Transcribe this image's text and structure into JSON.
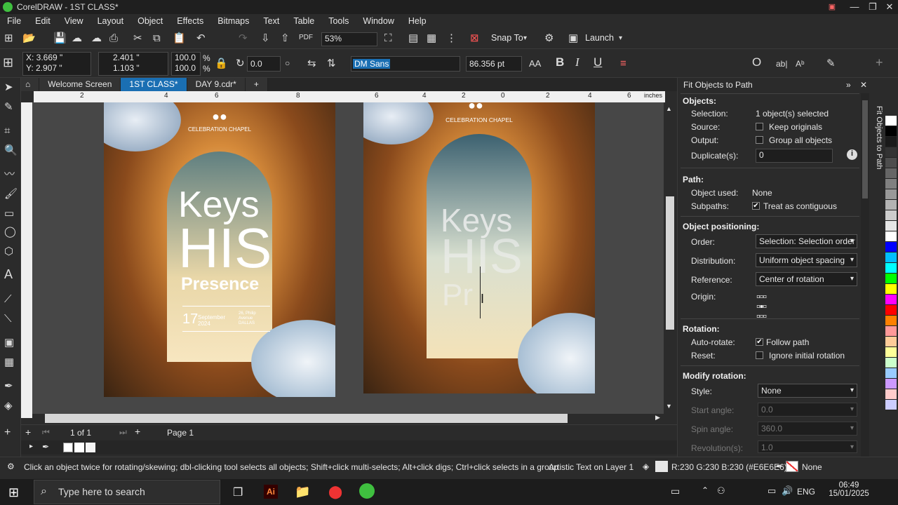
{
  "window": {
    "title": "CorelDRAW - 1ST CLASS*"
  },
  "menu": [
    "File",
    "Edit",
    "View",
    "Layout",
    "Object",
    "Effects",
    "Bitmaps",
    "Text",
    "Table",
    "Tools",
    "Window",
    "Help"
  ],
  "toolbar": {
    "zoom": "53%",
    "snap_label": "Snap To",
    "launch_label": "Launch"
  },
  "propbar": {
    "x": "X: 3.669 \"",
    "y": "Y: 2.907 \"",
    "w": "2.401 \"",
    "h": "1.103 \"",
    "sx": "100.0",
    "sy": "100.0",
    "pct": "%",
    "angle": "0.0",
    "font": "DM Sans",
    "size": "86.356 pt"
  },
  "tabs": [
    "Welcome Screen",
    "1ST CLASS*",
    "DAY 9.cdr*"
  ],
  "ruler": {
    "unit": "inches",
    "ticks": [
      "2",
      "4",
      "6",
      "8",
      "6",
      "4",
      "2",
      "0",
      "2",
      "4",
      "6"
    ]
  },
  "poster1": {
    "brand": "CELEBRATION CHAPEL",
    "title1": "Keys",
    "title2": "HIS",
    "title3": "Presence",
    "day": "17",
    "month": "September",
    "year": "2024",
    "addr1": "26, Philip",
    "addr2": "Avenue",
    "addr3": "DALLAS"
  },
  "poster2": {
    "brand": "CELEBRATION CHAPEL",
    "title1": "Keys",
    "title2": "HIS",
    "title3": "Pr"
  },
  "pagebar": {
    "page_count": "1 of 1",
    "page_tab": "Page 1"
  },
  "docker": {
    "title": "Fit Objects to Path",
    "side_label": "Fit Objects to Path",
    "objects_h": "Objects:",
    "selection_l": "Selection:",
    "selection_v": "1 object(s) selected",
    "source_l": "Source:",
    "source_v": "Keep originals",
    "output_l": "Output:",
    "output_v": "Group all objects",
    "dup_l": "Duplicate(s):",
    "dup_v": "0",
    "path_h": "Path:",
    "objused_l": "Object used:",
    "objused_v": "None",
    "subpaths_l": "Subpaths:",
    "subpaths_v": "Treat as contiguous",
    "pos_h": "Object positioning:",
    "order_l": "Order:",
    "order_v": "Selection: Selection order",
    "dist_l": "Distribution:",
    "dist_v": "Uniform object spacing",
    "ref_l": "Reference:",
    "ref_v": "Center of rotation",
    "origin_l": "Origin:",
    "rot_h": "Rotation:",
    "autorot_l": "Auto-rotate:",
    "autorot_v": "Follow path",
    "reset_l": "Reset:",
    "reset_v": "Ignore initial rotation",
    "modrot_h": "Modify rotation:",
    "style_l": "Style:",
    "style_v": "None",
    "start_l": "Start angle:",
    "start_v": "0.0",
    "spin_l": "Spin angle:",
    "spin_v": "360.0",
    "rev_l": "Revolution(s):",
    "rev_v": "1.0"
  },
  "palette_colors": [
    "#ffffff",
    "#000000",
    "#1a1a1a",
    "#333333",
    "#4d4d4d",
    "#666666",
    "#808080",
    "#999999",
    "#b3b3b3",
    "#cccccc",
    "#e6e6e6",
    "#ffffff",
    "#0000ff",
    "#00bfff",
    "#00ffff",
    "#00ff00",
    "#ffff00",
    "#ff00ff",
    "#ff0000",
    "#ff8000",
    "#ff9999",
    "#ffcc99",
    "#ffff99",
    "#ccffcc",
    "#99ccff",
    "#cc99ff",
    "#ffcccc",
    "#ccccff"
  ],
  "status": {
    "hint": "Click an object twice for rotating/skewing; dbl-clicking tool selects all objects; Shift+click multi-selects; Alt+click digs; Ctrl+click selects in a group",
    "layer": "Artistic Text on Layer 1",
    "fill": "R:230 G:230 B:230 (#E6E6E6)",
    "outline": "None"
  },
  "taskbar": {
    "search_placeholder": "Type here to search",
    "lang": "ENG",
    "time": "06:49",
    "date": "15/01/2025"
  }
}
